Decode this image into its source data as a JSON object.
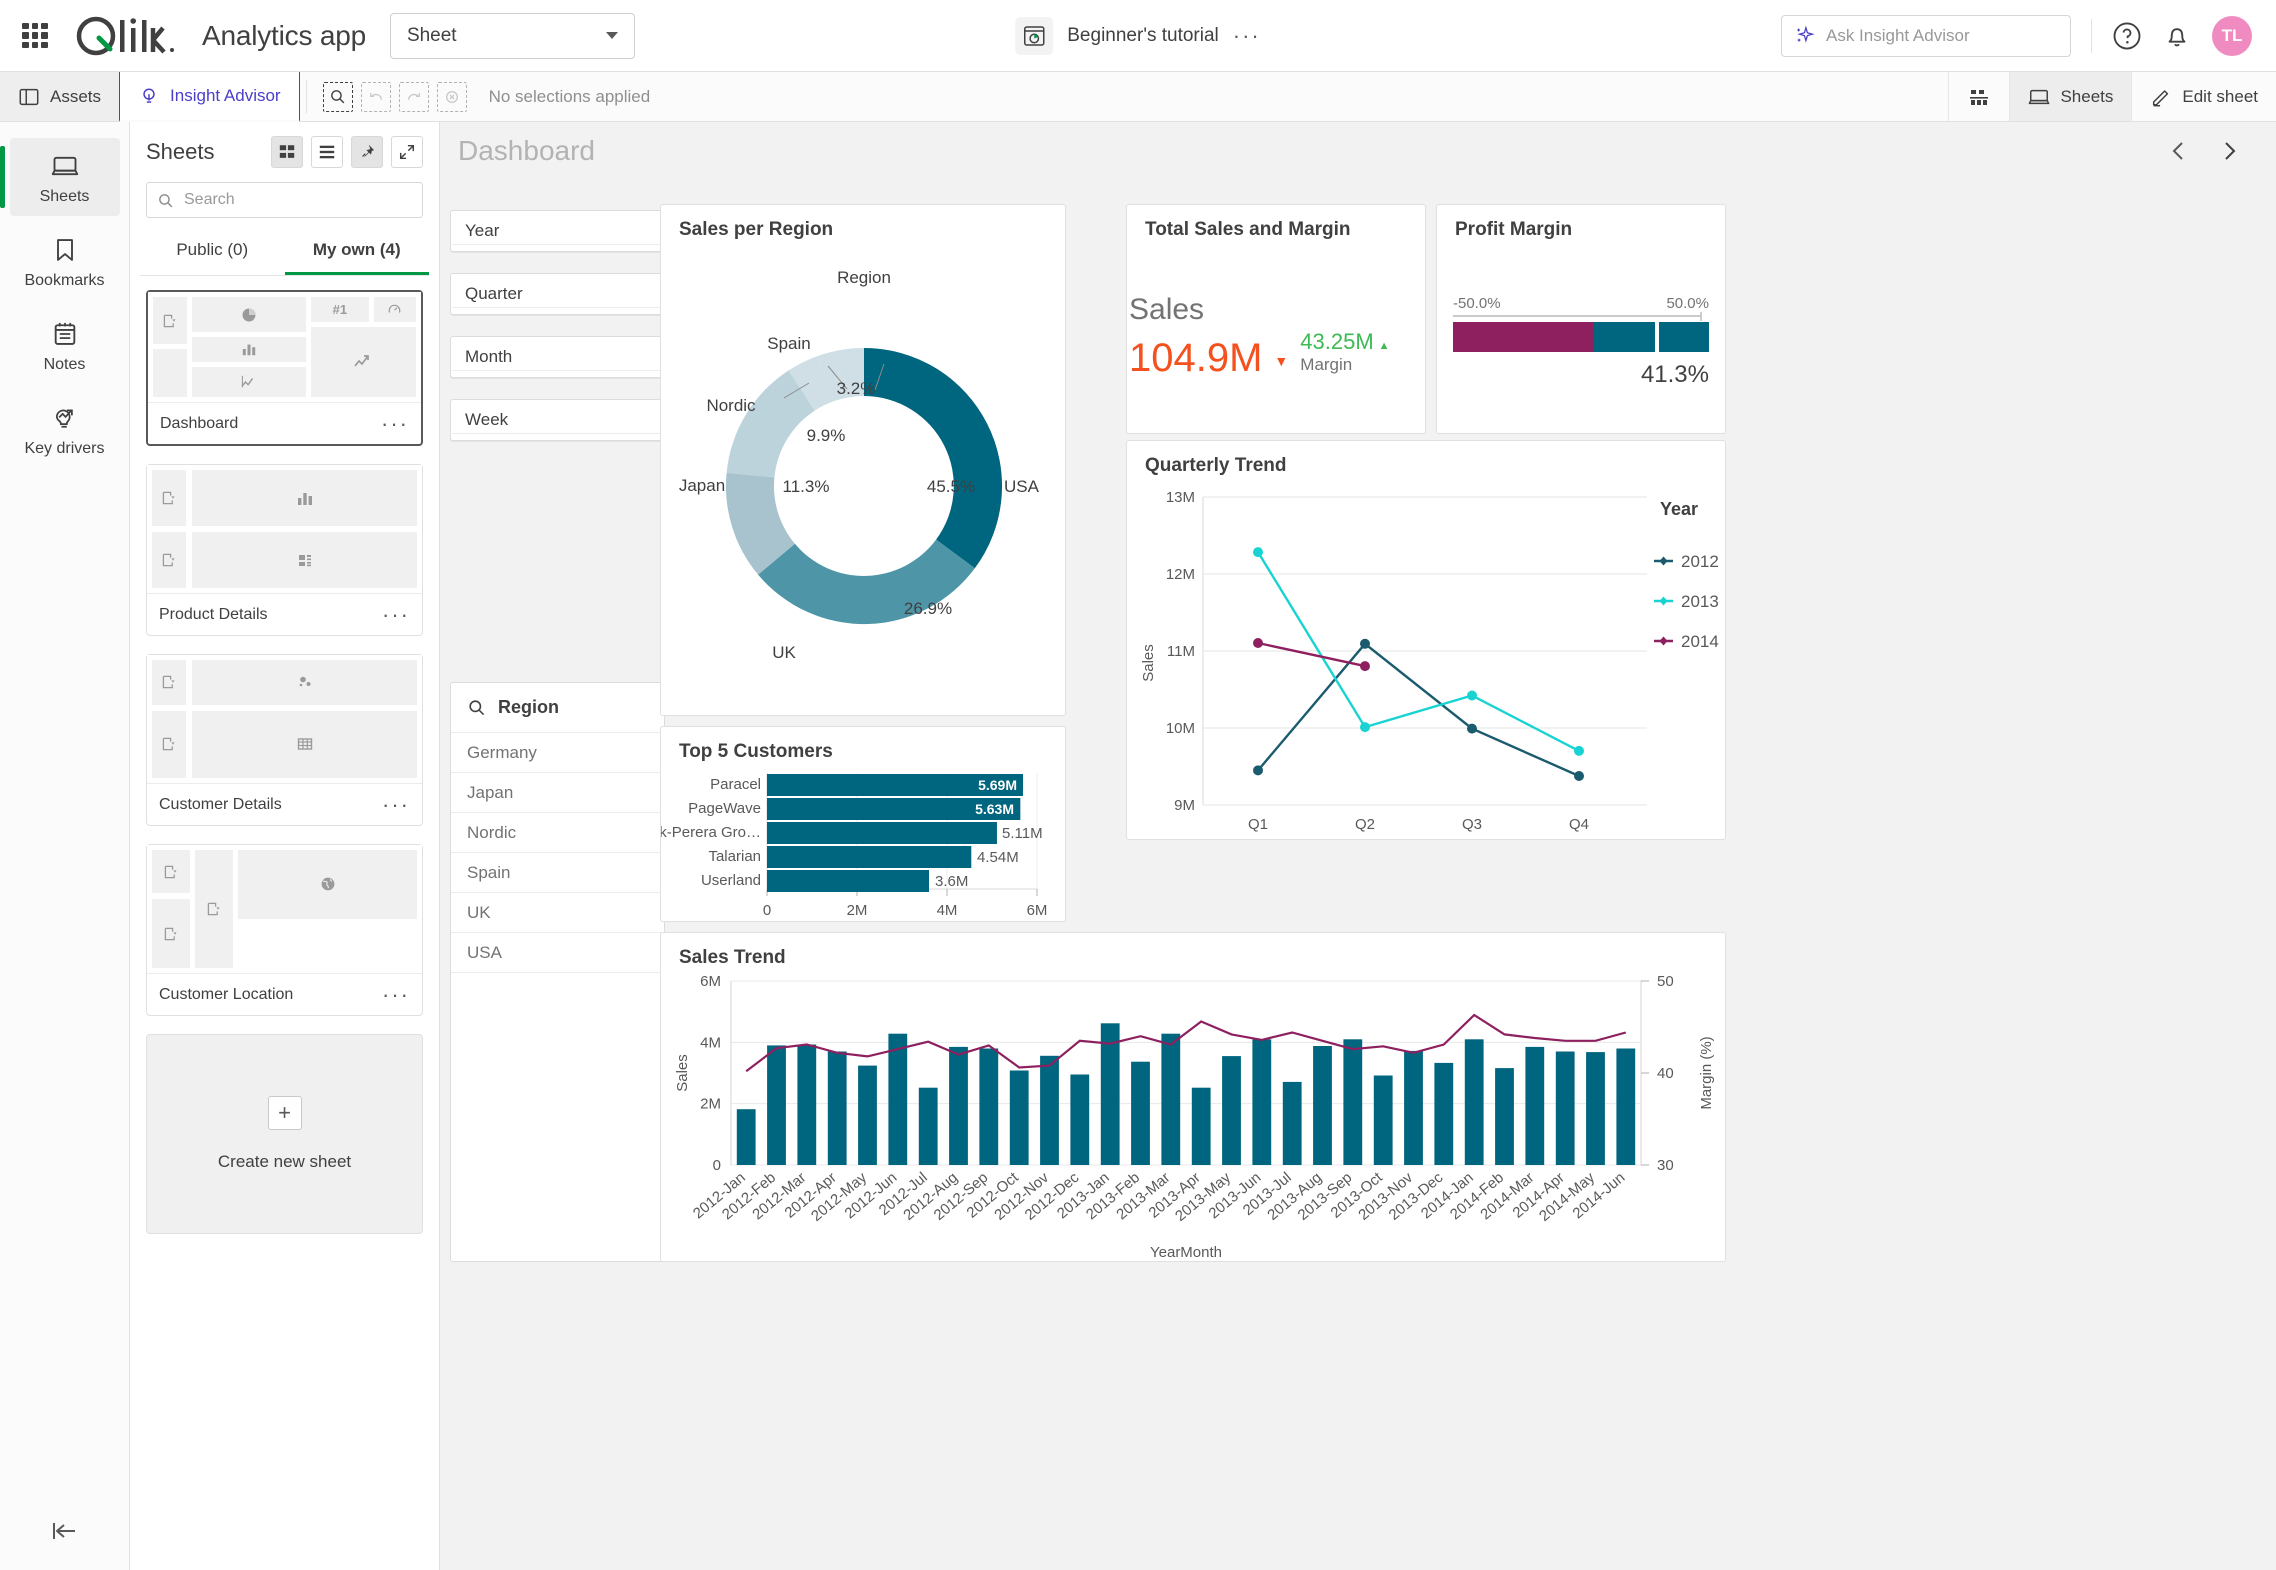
{
  "header": {
    "app_title": "Analytics app",
    "sheet_selector": "Sheet",
    "doc_name": "Beginner's tutorial",
    "doc_menu": "···",
    "ask_placeholder": "Ask Insight Advisor",
    "avatar_initials": "TL",
    "icons": {
      "grid": "app-grid-icon",
      "help": "help-icon",
      "bell": "notifications-icon"
    }
  },
  "toolbar": {
    "assets": "Assets",
    "insight_advisor": "Insight Advisor",
    "selection_status": "No selections applied",
    "sheets": "Sheets",
    "edit_sheet": "Edit sheet"
  },
  "rail": {
    "items": [
      {
        "label": "Sheets",
        "icon": "sheets-icon",
        "active": true
      },
      {
        "label": "Bookmarks",
        "icon": "bookmark-icon",
        "active": false
      },
      {
        "label": "Notes",
        "icon": "notes-icon",
        "active": false
      },
      {
        "label": "Key drivers",
        "icon": "key-drivers-icon",
        "active": false
      }
    ],
    "collapse": "collapse-panel-icon"
  },
  "sheets_panel": {
    "title": "Sheets",
    "search_placeholder": "Search",
    "tabs": [
      {
        "label": "Public (0)",
        "active": false
      },
      {
        "label": "My own (4)",
        "active": true
      }
    ],
    "sheets": [
      {
        "name": "Dashboard",
        "selected": true
      },
      {
        "name": "Product Details",
        "selected": false
      },
      {
        "name": "Customer Details",
        "selected": false
      },
      {
        "name": "Customer Location",
        "selected": false
      }
    ],
    "create_new": "Create new sheet"
  },
  "sheet": {
    "name": "Dashboard",
    "prev": "previous-sheet-icon",
    "next": "next-sheet-icon"
  },
  "filters": [
    "Year",
    "Quarter",
    "Month",
    "Week"
  ],
  "region_filter": {
    "title": "Region",
    "values": [
      "Germany",
      "Japan",
      "Nordic",
      "Spain",
      "UK",
      "USA"
    ]
  },
  "kpi": {
    "title": "Total Sales and Margin",
    "sales_label": "Sales",
    "sales_value": "104.9M",
    "margin_value": "43.25M",
    "margin_label": "Margin",
    "sales_color": "#f4511e",
    "margin_color": "#3cba54"
  },
  "gauge": {
    "title": "Profit Margin",
    "min_label": "-50.0%",
    "max_label": "50.0%",
    "value_label": "41.3%",
    "value": 41.3,
    "min": -50,
    "max": 50,
    "band_color": "#8e2060",
    "fill_color": "#00657e"
  },
  "chart_data": [
    {
      "id": "sales-per-region",
      "type": "pie",
      "title": "Sales per Region",
      "legend_title": "Region",
      "labels": [
        "USA",
        "UK",
        "Japan",
        "Nordic",
        "Spain"
      ],
      "values": [
        45.5,
        26.9,
        11.3,
        9.9,
        3.2
      ],
      "value_labels": [
        "45.5%",
        "26.9%",
        "11.3%",
        "9.9%",
        "3.2%"
      ],
      "colors": [
        "#00657e",
        "#4e95a8",
        "#a8c3cd",
        "#bdd3db",
        "#cfdfe5"
      ],
      "donut": true
    },
    {
      "id": "top-5-customers",
      "type": "bar",
      "title": "Top 5 Customers",
      "orientation": "horizontal",
      "categories": [
        "Paracel",
        "PageWave",
        "Deak-Perera Gro…",
        "Talarian",
        "Userland"
      ],
      "values": [
        5.69,
        5.63,
        5.11,
        4.54,
        3.6
      ],
      "value_labels": [
        "5.69M",
        "5.63M",
        "5.11M",
        "4.54M",
        "3.6M"
      ],
      "xticks": [
        "0",
        "2M",
        "4M",
        "6M"
      ],
      "xlim": [
        0,
        6
      ],
      "bar_color": "#00657e",
      "xlabel": "",
      "ylabel": ""
    },
    {
      "id": "quarterly-trend",
      "type": "line",
      "title": "Quarterly Trend",
      "categories": [
        "Q1",
        "Q2",
        "Q3",
        "Q4"
      ],
      "ylabel": "Sales",
      "yticks": [
        "9M",
        "10M",
        "11M",
        "12M",
        "13M"
      ],
      "ylim": [
        9,
        13
      ],
      "legend_title": "Year",
      "legend_position": "right",
      "series": [
        {
          "name": "2012",
          "color": "#1a5b6e",
          "values": [
            9.55,
            11.12,
            10.07,
            9.48
          ]
        },
        {
          "name": "2013",
          "color": "#19d3d3",
          "values": [
            12.18,
            10.16,
            10.57,
            9.85
          ]
        },
        {
          "name": "2014",
          "color": "#8e2060",
          "values": [
            11.11,
            10.81,
            null,
            null
          ]
        }
      ]
    },
    {
      "id": "sales-trend",
      "type": "bar",
      "title": "Sales Trend",
      "xlabel": "YearMonth",
      "ylabel": "Sales",
      "y2label": "Margin (%)",
      "yticks": [
        "0",
        "2M",
        "4M",
        "6M"
      ],
      "ylim": [
        0,
        6
      ],
      "y2ticks": [
        "30",
        "40",
        "50"
      ],
      "y2lim": [
        30,
        50
      ],
      "bar_color": "#00657e",
      "line_color": "#8e2060",
      "categories": [
        "2012-Jan",
        "2012-Feb",
        "2012-Mar",
        "2012-Apr",
        "2012-May",
        "2012-Jun",
        "2012-Jul",
        "2012-Aug",
        "2012-Sep",
        "2012-Oct",
        "2012-Nov",
        "2012-Dec",
        "2013-Jan",
        "2013-Feb",
        "2013-Mar",
        "2013-Apr",
        "2013-May",
        "2013-Jun",
        "2013-Jul",
        "2013-Aug",
        "2013-Sep",
        "2013-Oct",
        "2013-Nov",
        "2013-Dec",
        "2014-Jan",
        "2014-Feb",
        "2014-Mar",
        "2014-Apr",
        "2014-May",
        "2014-Jun"
      ],
      "series": [
        {
          "name": "Sales",
          "type": "bar",
          "axis": "left",
          "values": [
            1.82,
            3.9,
            3.93,
            3.7,
            3.24,
            4.28,
            2.52,
            3.85,
            3.8,
            3.08,
            3.56,
            2.95,
            4.62,
            3.37,
            4.28,
            2.52,
            3.55,
            4.1,
            2.71,
            3.88,
            4.1,
            2.92,
            3.72,
            3.33,
            4.1,
            3.16,
            3.85,
            3.7,
            3.68,
            3.8
          ]
        },
        {
          "name": "Margin",
          "type": "line",
          "axis": "right",
          "values": [
            40.2,
            42.7,
            43.1,
            42.2,
            41.8,
            42.6,
            43.4,
            42.0,
            43.0,
            40.6,
            40.8,
            43.5,
            43.2,
            44.0,
            43.1,
            45.6,
            44.2,
            43.6,
            44.4,
            43.5,
            42.6,
            42.9,
            42.2,
            43.1,
            46.3,
            44.2,
            43.8,
            43.5,
            43.5,
            44.4
          ]
        }
      ]
    }
  ]
}
